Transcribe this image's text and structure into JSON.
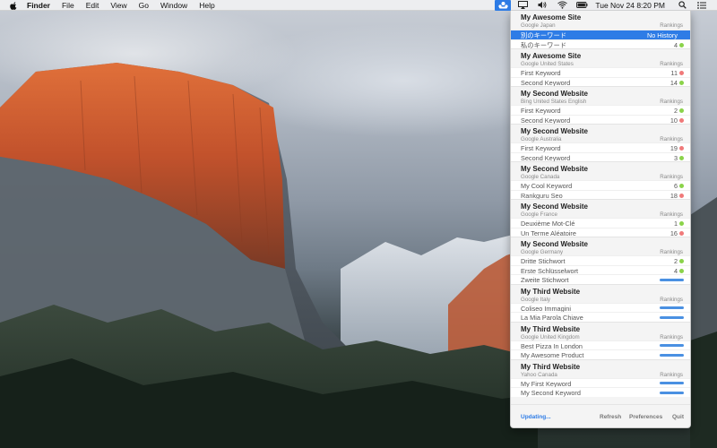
{
  "menubar": {
    "app_name": "Finder",
    "menus": [
      "File",
      "Edit",
      "View",
      "Go",
      "Window",
      "Help"
    ],
    "clock": "Tue Nov 24  8:20 PM"
  },
  "sites": [
    {
      "name": "My Awesome Site",
      "engine": "Google Japan",
      "rankings_label": "Rankings",
      "keywords": [
        {
          "label": "別のキーワード",
          "value": "No History",
          "status": "none",
          "selected": true
        },
        {
          "label": "私のキーワード",
          "value": "4",
          "status": "up"
        }
      ]
    },
    {
      "name": "My Awesome Site",
      "engine": "Google United States",
      "rankings_label": "Rankings",
      "keywords": [
        {
          "label": "First Keyword",
          "value": "11",
          "status": "down"
        },
        {
          "label": "Second Keyword",
          "value": "14",
          "status": "up"
        }
      ]
    },
    {
      "name": "My Second Website",
      "engine": "Bing United States English",
      "rankings_label": "Rankings",
      "keywords": [
        {
          "label": "First Keyword",
          "value": "2",
          "status": "up"
        },
        {
          "label": "Second Keyword",
          "value": "10",
          "status": "down"
        }
      ]
    },
    {
      "name": "My Second Website",
      "engine": "Google Australia",
      "rankings_label": "Rankings",
      "keywords": [
        {
          "label": "First Keyword",
          "value": "19",
          "status": "down"
        },
        {
          "label": "Second Keyword",
          "value": "3",
          "status": "up"
        }
      ]
    },
    {
      "name": "My Second Website",
      "engine": "Google Canada",
      "rankings_label": "Rankings",
      "keywords": [
        {
          "label": "My Cool Keyword",
          "value": "6",
          "status": "up"
        },
        {
          "label": "Rankguru Seo",
          "value": "18",
          "status": "down"
        }
      ]
    },
    {
      "name": "My Second Website",
      "engine": "Google France",
      "rankings_label": "Rankings",
      "keywords": [
        {
          "label": "Deuxième Mot-Clé",
          "value": "1",
          "status": "up"
        },
        {
          "label": "Un Terme Aléatoire",
          "value": "16",
          "status": "down"
        }
      ]
    },
    {
      "name": "My Second Website",
      "engine": "Google Germany",
      "rankings_label": "Rankings",
      "keywords": [
        {
          "label": "Dritte Stichwort",
          "value": "2",
          "status": "up"
        },
        {
          "label": "Erste Schlüsselwort",
          "value": "4",
          "status": "up"
        },
        {
          "label": "Zweite Stichwort",
          "value": "",
          "status": "loading"
        }
      ]
    },
    {
      "name": "My Third Website",
      "engine": "Google Italy",
      "rankings_label": "Rankings",
      "keywords": [
        {
          "label": "Coliseo Immagini",
          "value": "",
          "status": "loading"
        },
        {
          "label": "La Mia Parola Chiave",
          "value": "",
          "status": "loading"
        }
      ]
    },
    {
      "name": "My Third Website",
      "engine": "Google United Kingdom",
      "rankings_label": "Rankings",
      "keywords": [
        {
          "label": "Best Pizza In London",
          "value": "",
          "status": "loading"
        },
        {
          "label": "My Awesome Product",
          "value": "",
          "status": "loading"
        }
      ]
    },
    {
      "name": "My Third Website",
      "engine": "Yahoo Canada",
      "rankings_label": "Rankings",
      "keywords": [
        {
          "label": "My First Keyword",
          "value": "",
          "status": "loading"
        },
        {
          "label": "My Second Keyword",
          "value": "",
          "status": "loading"
        }
      ]
    }
  ],
  "footer": {
    "status": "Updating...",
    "refresh": "Refresh",
    "preferences": "Preferences",
    "quit": "Quit"
  },
  "colors": {
    "accent": "#2e7ce6",
    "up": "#8bd34a",
    "down": "#f07a7a",
    "loading": "#4a90e2"
  }
}
